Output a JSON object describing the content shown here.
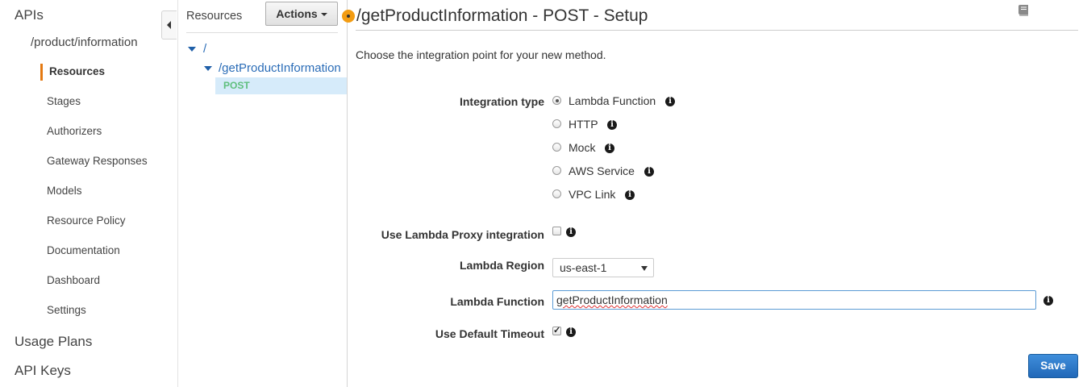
{
  "leftnav": {
    "apis_label": "APIs",
    "api_name": "/product/information",
    "items": [
      "Resources",
      "Stages",
      "Authorizers",
      "Gateway Responses",
      "Models",
      "Resource Policy",
      "Documentation",
      "Dashboard",
      "Settings"
    ],
    "active_item": "Resources",
    "usage_plans": "Usage Plans",
    "api_keys": "API Keys"
  },
  "resources": {
    "title": "Resources",
    "actions_label": "Actions",
    "tree": {
      "root": "/",
      "child": "/getProductInformation",
      "method": "POST"
    }
  },
  "main": {
    "title": "/getProductInformation - POST - Setup",
    "instructions": "Choose the integration point for your new method.",
    "integration_type_label": "Integration type",
    "integration_options": [
      "Lambda Function",
      "HTTP",
      "Mock",
      "AWS Service",
      "VPC Link"
    ],
    "selected_integration": "Lambda Function",
    "proxy_label": "Use Lambda Proxy integration",
    "proxy_checked": false,
    "region_label": "Lambda Region",
    "region_value": "us-east-1",
    "function_label": "Lambda Function",
    "function_value": "getProductInformation",
    "timeout_label": "Use Default Timeout",
    "timeout_checked": true,
    "save_label": "Save"
  },
  "colors": {
    "accent_orange": "#e47911",
    "link_blue": "#2a6cb7",
    "method_green": "#5fbf7d",
    "save_blue": "#2168b8"
  }
}
